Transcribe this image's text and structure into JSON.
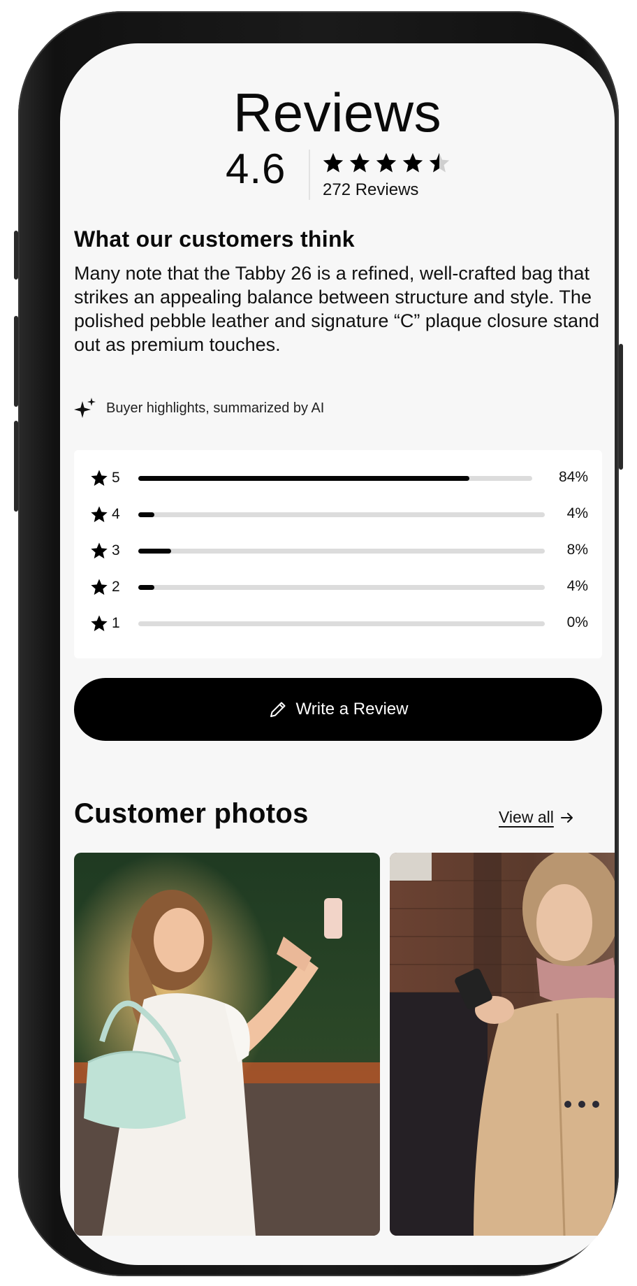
{
  "header": {
    "title": "Reviews",
    "rating": "4.6",
    "review_count": "272 Reviews",
    "stars": [
      "star-full",
      "star-full",
      "star-full",
      "star-full",
      "star-half"
    ]
  },
  "summary": {
    "heading": "What our customers think",
    "text": "Many note that the Tabby 26 is a refined, well-crafted bag that strikes an appealing balance between structure and style. The polished pebble leather and signature “C” plaque closure stand out as premium touches.",
    "ai_note": "Buyer highlights, summarized by AI",
    "ai_icon": "sparkle-icon"
  },
  "distribution": [
    {
      "stars": "5",
      "percent_label": "84%",
      "fraction": 0.84
    },
    {
      "stars": "4",
      "percent_label": "4%",
      "fraction": 0.04
    },
    {
      "stars": "3",
      "percent_label": "8%",
      "fraction": 0.08
    },
    {
      "stars": "2",
      "percent_label": "4%",
      "fraction": 0.04
    },
    {
      "stars": "1",
      "percent_label": "0%",
      "fraction": 0.0
    }
  ],
  "actions": {
    "write_review_label": "Write a Review",
    "write_review_icon": "pencil-icon"
  },
  "photos": {
    "heading": "Customer photos",
    "view_all_label": "View all",
    "view_all_icon": "arrow-right-icon",
    "items": [
      {
        "description_name": "customer-photo-selfie-with-bag"
      },
      {
        "description_name": "customer-photo-woman-with-phone"
      }
    ]
  },
  "colors": {
    "accent": "#000000",
    "background": "#f7f7f7",
    "card": "#ffffff",
    "bar_track": "#dcdcdc"
  }
}
